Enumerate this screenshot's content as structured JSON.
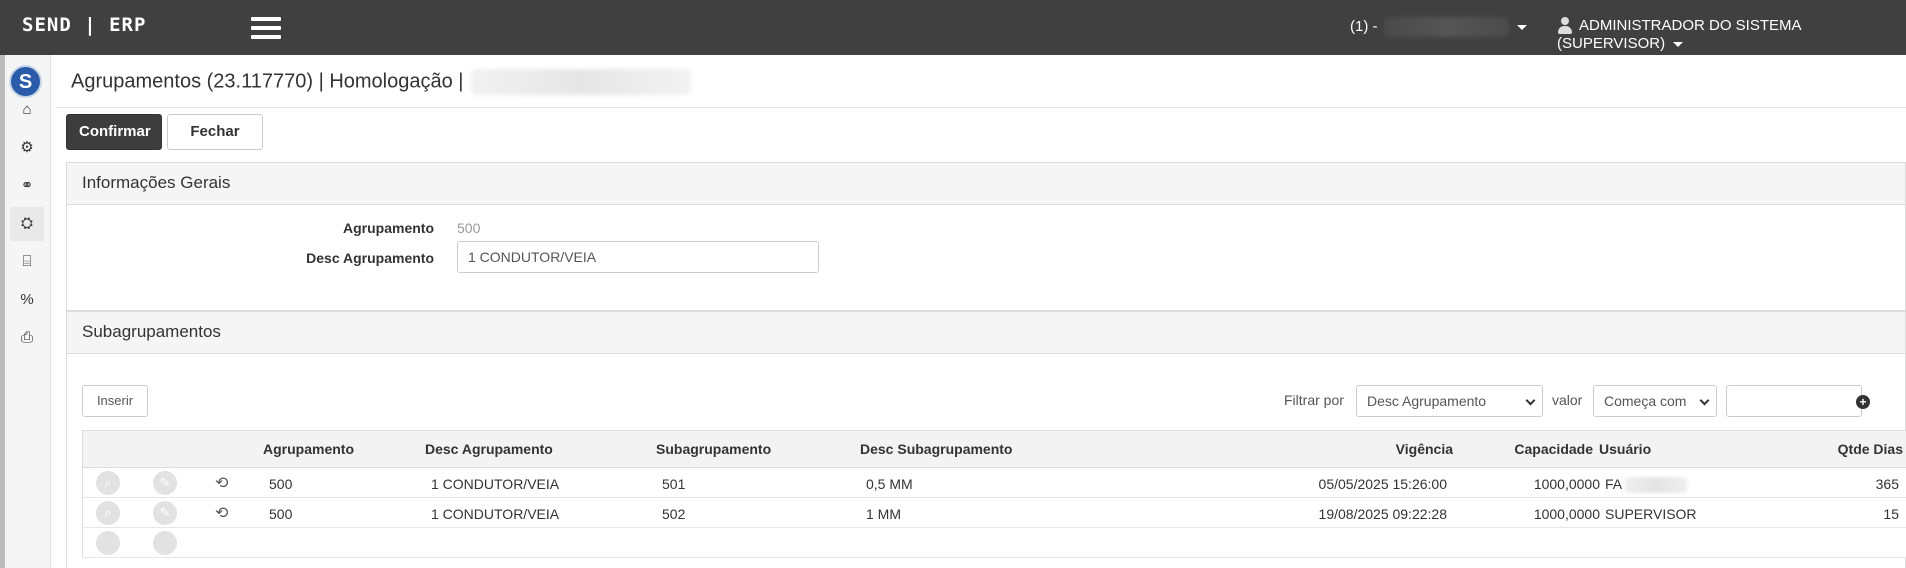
{
  "app": {
    "brand": "SEND | ERP"
  },
  "topbar": {
    "company_prefix": "(1) -",
    "user_label": "ADMINISTRADOR DO SISTEMA (SUPERVISOR)"
  },
  "sidebar": {
    "logo_letter": "S",
    "items": [
      {
        "name": "home",
        "icon": "⌂"
      },
      {
        "name": "gears",
        "icon": "⚙"
      },
      {
        "name": "handshake",
        "icon": "⚭"
      },
      {
        "name": "cubes",
        "icon": "⛭"
      },
      {
        "name": "bank",
        "icon": "⌸"
      },
      {
        "name": "percent",
        "icon": "%"
      },
      {
        "name": "print",
        "icon": "⎙"
      }
    ]
  },
  "page": {
    "title": "Agrupamentos (23.117770) | Homologação |"
  },
  "toolbar": {
    "confirm_label": "Confirmar",
    "close_label": "Fechar"
  },
  "general_info": {
    "heading": "Informações Gerais",
    "agrupamento_label": "Agrupamento",
    "agrupamento_value": "500",
    "desc_label": "Desc Agrupamento",
    "desc_value": "1 CONDUTOR/VEIA"
  },
  "subgroups": {
    "heading": "Subagrupamentos",
    "insert_label": "Inserir",
    "filter_by_label": "Filtrar por",
    "filter_field": "Desc Agrupamento",
    "value_label": "valor",
    "filter_operator": "Começa com",
    "filter_value": "",
    "add_filter_icon": "+",
    "columns": [
      "Agrupamento",
      "Desc Agrupamento",
      "Subagrupamento",
      "Desc Subagrupamento",
      "Vigência",
      "Capacidade",
      "Usuário",
      "Qtde Dias"
    ],
    "rows": [
      {
        "agrupamento": "500",
        "desc_agrupamento": "1 CONDUTOR/VEIA",
        "subagrupamento": "501",
        "desc_subagrupamento": "0,5 MM",
        "vigencia": "05/05/2025 15:26:00",
        "capacidade": "1000,0000",
        "usuario": "FA",
        "qtde_dias": "365"
      },
      {
        "agrupamento": "500",
        "desc_agrupamento": "1 CONDUTOR/VEIA",
        "subagrupamento": "502",
        "desc_subagrupamento": "1 MM",
        "vigencia": "19/08/2025 09:22:28",
        "capacidade": "1000,0000",
        "usuario": "SUPERVISOR",
        "qtde_dias": "15"
      }
    ]
  }
}
